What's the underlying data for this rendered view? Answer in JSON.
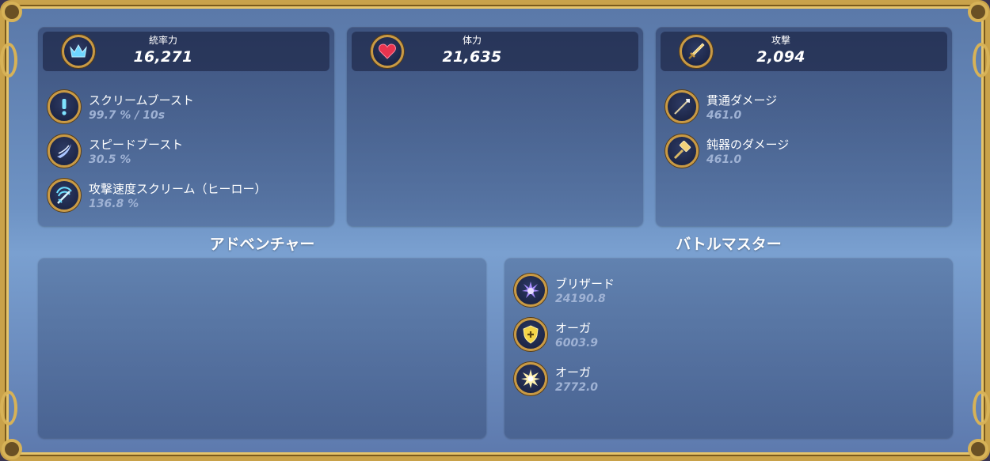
{
  "stats": {
    "command": {
      "label": "統率力",
      "value": "16,271",
      "icon": "crown-icon"
    },
    "health": {
      "label": "体力",
      "value": "21,635",
      "icon": "heart-icon"
    },
    "attack": {
      "label": "攻撃",
      "value": "2,094",
      "icon": "sword-icon"
    }
  },
  "command_buffs": [
    {
      "name": "スクリームブースト",
      "value": "99.7 % / 10s",
      "icon": "exclamation-icon"
    },
    {
      "name": "スピードブースト",
      "value": "30.5 %",
      "icon": "wing-icon"
    },
    {
      "name": "攻撃速度スクリーム（ヒーロー）",
      "value": "136.8 %",
      "icon": "scream-sword-icon"
    }
  ],
  "attack_buffs": [
    {
      "name": "貫通ダメージ",
      "value": "461.0",
      "icon": "spear-icon"
    },
    {
      "name": "鈍器のダメージ",
      "value": "461.0",
      "icon": "hammer-icon"
    }
  ],
  "sections": {
    "adventure": {
      "title": "アドベンチャー"
    },
    "battle_master": {
      "title": "バトルマスター"
    }
  },
  "battle_master_items": [
    {
      "name": "ブリザード",
      "value": "24190.8",
      "icon": "blizzard-burst-icon"
    },
    {
      "name": "オーガ",
      "value": "6003.9",
      "icon": "shield-plus-icon"
    },
    {
      "name": "オーガ",
      "value": "2772.0",
      "icon": "star-burst-icon"
    }
  ],
  "colors": {
    "gold_frame": "#c9a24a",
    "value_text": "#9fb2d4",
    "heart": "#e8344f",
    "crown": "#6fd6ff"
  }
}
